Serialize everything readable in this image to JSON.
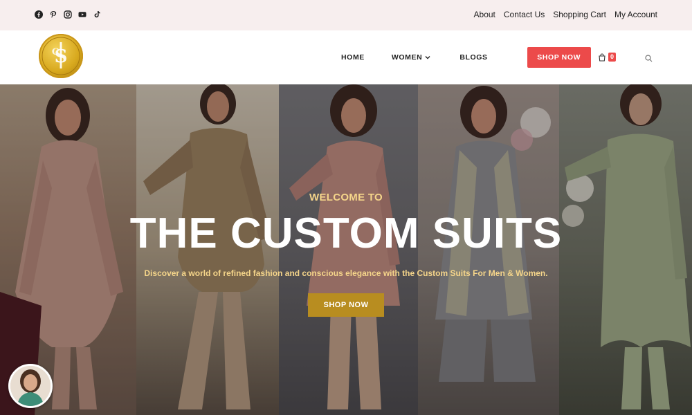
{
  "topbar": {
    "social_icons": [
      "facebook-icon",
      "pinterest-icon",
      "instagram-icon",
      "youtube-icon",
      "tiktok-icon"
    ],
    "links": [
      "About",
      "Contact Us",
      "Shopping Cart",
      "My Account"
    ]
  },
  "header": {
    "nav": {
      "home": "HOME",
      "women": "WOMEN",
      "blogs": "BLOGS",
      "shop_now": "SHOP NOW"
    },
    "cart_count": "0"
  },
  "hero": {
    "welcome": "WELCOME TO",
    "title": "THE CUSTOM SUITS",
    "subtitle": "Discover a world of refined fashion and conscious elegance with the Custom Suits For Men & Women.",
    "button": "SHOP NOW"
  },
  "colors": {
    "topbar_bg": "#f7eeee",
    "accent_red": "#ec4a4a",
    "gold": "#b88d20",
    "welcome_gold": "#f5d58a"
  }
}
